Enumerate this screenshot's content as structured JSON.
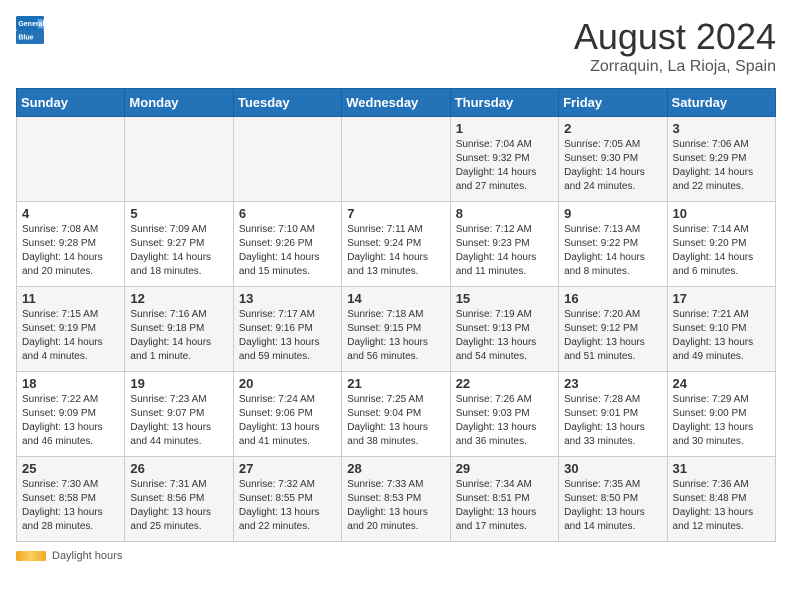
{
  "header": {
    "logo_line1": "General",
    "logo_line2": "Blue",
    "month_title": "August 2024",
    "location": "Zorraquin, La Rioja, Spain"
  },
  "days_of_week": [
    "Sunday",
    "Monday",
    "Tuesday",
    "Wednesday",
    "Thursday",
    "Friday",
    "Saturday"
  ],
  "weeks": [
    [
      {
        "day": "",
        "info": ""
      },
      {
        "day": "",
        "info": ""
      },
      {
        "day": "",
        "info": ""
      },
      {
        "day": "",
        "info": ""
      },
      {
        "day": "1",
        "info": "Sunrise: 7:04 AM\nSunset: 9:32 PM\nDaylight: 14 hours\nand 27 minutes."
      },
      {
        "day": "2",
        "info": "Sunrise: 7:05 AM\nSunset: 9:30 PM\nDaylight: 14 hours\nand 24 minutes."
      },
      {
        "day": "3",
        "info": "Sunrise: 7:06 AM\nSunset: 9:29 PM\nDaylight: 14 hours\nand 22 minutes."
      }
    ],
    [
      {
        "day": "4",
        "info": "Sunrise: 7:08 AM\nSunset: 9:28 PM\nDaylight: 14 hours\nand 20 minutes."
      },
      {
        "day": "5",
        "info": "Sunrise: 7:09 AM\nSunset: 9:27 PM\nDaylight: 14 hours\nand 18 minutes."
      },
      {
        "day": "6",
        "info": "Sunrise: 7:10 AM\nSunset: 9:26 PM\nDaylight: 14 hours\nand 15 minutes."
      },
      {
        "day": "7",
        "info": "Sunrise: 7:11 AM\nSunset: 9:24 PM\nDaylight: 14 hours\nand 13 minutes."
      },
      {
        "day": "8",
        "info": "Sunrise: 7:12 AM\nSunset: 9:23 PM\nDaylight: 14 hours\nand 11 minutes."
      },
      {
        "day": "9",
        "info": "Sunrise: 7:13 AM\nSunset: 9:22 PM\nDaylight: 14 hours\nand 8 minutes."
      },
      {
        "day": "10",
        "info": "Sunrise: 7:14 AM\nSunset: 9:20 PM\nDaylight: 14 hours\nand 6 minutes."
      }
    ],
    [
      {
        "day": "11",
        "info": "Sunrise: 7:15 AM\nSunset: 9:19 PM\nDaylight: 14 hours\nand 4 minutes."
      },
      {
        "day": "12",
        "info": "Sunrise: 7:16 AM\nSunset: 9:18 PM\nDaylight: 14 hours\nand 1 minute."
      },
      {
        "day": "13",
        "info": "Sunrise: 7:17 AM\nSunset: 9:16 PM\nDaylight: 13 hours\nand 59 minutes."
      },
      {
        "day": "14",
        "info": "Sunrise: 7:18 AM\nSunset: 9:15 PM\nDaylight: 13 hours\nand 56 minutes."
      },
      {
        "day": "15",
        "info": "Sunrise: 7:19 AM\nSunset: 9:13 PM\nDaylight: 13 hours\nand 54 minutes."
      },
      {
        "day": "16",
        "info": "Sunrise: 7:20 AM\nSunset: 9:12 PM\nDaylight: 13 hours\nand 51 minutes."
      },
      {
        "day": "17",
        "info": "Sunrise: 7:21 AM\nSunset: 9:10 PM\nDaylight: 13 hours\nand 49 minutes."
      }
    ],
    [
      {
        "day": "18",
        "info": "Sunrise: 7:22 AM\nSunset: 9:09 PM\nDaylight: 13 hours\nand 46 minutes."
      },
      {
        "day": "19",
        "info": "Sunrise: 7:23 AM\nSunset: 9:07 PM\nDaylight: 13 hours\nand 44 minutes."
      },
      {
        "day": "20",
        "info": "Sunrise: 7:24 AM\nSunset: 9:06 PM\nDaylight: 13 hours\nand 41 minutes."
      },
      {
        "day": "21",
        "info": "Sunrise: 7:25 AM\nSunset: 9:04 PM\nDaylight: 13 hours\nand 38 minutes."
      },
      {
        "day": "22",
        "info": "Sunrise: 7:26 AM\nSunset: 9:03 PM\nDaylight: 13 hours\nand 36 minutes."
      },
      {
        "day": "23",
        "info": "Sunrise: 7:28 AM\nSunset: 9:01 PM\nDaylight: 13 hours\nand 33 minutes."
      },
      {
        "day": "24",
        "info": "Sunrise: 7:29 AM\nSunset: 9:00 PM\nDaylight: 13 hours\nand 30 minutes."
      }
    ],
    [
      {
        "day": "25",
        "info": "Sunrise: 7:30 AM\nSunset: 8:58 PM\nDaylight: 13 hours\nand 28 minutes."
      },
      {
        "day": "26",
        "info": "Sunrise: 7:31 AM\nSunset: 8:56 PM\nDaylight: 13 hours\nand 25 minutes."
      },
      {
        "day": "27",
        "info": "Sunrise: 7:32 AM\nSunset: 8:55 PM\nDaylight: 13 hours\nand 22 minutes."
      },
      {
        "day": "28",
        "info": "Sunrise: 7:33 AM\nSunset: 8:53 PM\nDaylight: 13 hours\nand 20 minutes."
      },
      {
        "day": "29",
        "info": "Sunrise: 7:34 AM\nSunset: 8:51 PM\nDaylight: 13 hours\nand 17 minutes."
      },
      {
        "day": "30",
        "info": "Sunrise: 7:35 AM\nSunset: 8:50 PM\nDaylight: 13 hours\nand 14 minutes."
      },
      {
        "day": "31",
        "info": "Sunrise: 7:36 AM\nSunset: 8:48 PM\nDaylight: 13 hours\nand 12 minutes."
      }
    ]
  ],
  "footer": {
    "daylight_label": "Daylight hours"
  }
}
